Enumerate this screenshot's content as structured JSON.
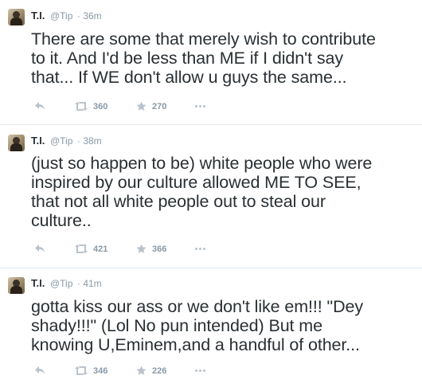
{
  "colors": {
    "text": "#292f33",
    "meta": "#8899a6",
    "icon": "#bac3cb",
    "divider": "#e1e8ed"
  },
  "tweets": [
    {
      "name": "T.I.",
      "handle": "@Tip",
      "time": "· 36m",
      "text_lines": [
        "There are some that merely wish to contribute",
        "to it. And I'd be less than ME if I didn't say",
        "that... If WE don't allow u guys the same..."
      ],
      "retweets": "360",
      "favorites": "270"
    },
    {
      "name": "T.I.",
      "handle": "@Tip",
      "time": "· 38m",
      "text_lines": [
        "(just so happen to be) white people who were",
        "inspired by our culture allowed ME TO SEE,",
        "that not all white people out to steal our",
        "culture.."
      ],
      "retweets": "421",
      "favorites": "366"
    },
    {
      "name": "T.I.",
      "handle": "@Tip",
      "time": "· 41m",
      "text_lines": [
        "gotta kiss our ass or we don't like em!!! \"Dey",
        "shady!!!\" (Lol No pun intended) But me",
        "knowing U,Eminem,and a handful of other..."
      ],
      "retweets": "346",
      "favorites": "226"
    }
  ],
  "icons": {
    "avatar": "avatar-image",
    "reply": "reply-icon",
    "retweet": "retweet-icon",
    "favorite": "star-icon",
    "more": "more-dots-icon"
  }
}
